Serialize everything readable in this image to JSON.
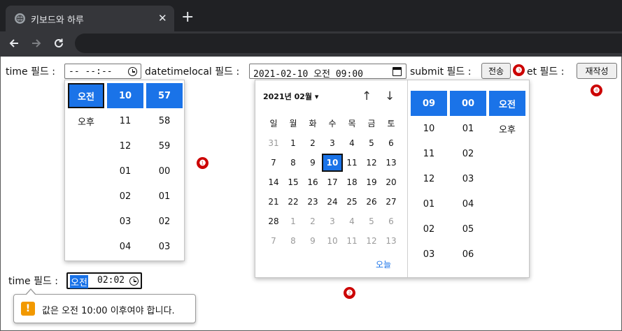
{
  "browser": {
    "tab_title": "키보드와 하루",
    "tab_close": "✕",
    "new_tab": "+"
  },
  "form": {
    "time_label": "time 필드 :",
    "time_value": "-- --:--",
    "datetimelocal_label": "datetimelocal 필드 :",
    "datetimelocal_value": "2021-02-10 오전 09:00",
    "submit_label": "submit 필드 :",
    "submit_button": "전송",
    "reset_label": "et 필드 :",
    "reset_button": "재작성",
    "time2_label": "time 필드 :",
    "time2_ampm": "오전",
    "time2_value": "02:02"
  },
  "time_picker": {
    "ampm": [
      "오전",
      "오후"
    ],
    "hours": [
      "10",
      "11",
      "12",
      "01",
      "02",
      "03",
      "04"
    ],
    "minutes": [
      "57",
      "58",
      "59",
      "00",
      "01",
      "02",
      "03"
    ]
  },
  "calendar": {
    "month_label": "2021년 02월 ▾",
    "up_arrow": "↑",
    "down_arrow": "↓",
    "weekdays": [
      "일",
      "월",
      "화",
      "수",
      "목",
      "금",
      "토"
    ],
    "weeks": [
      [
        "31",
        "1",
        "2",
        "3",
        "4",
        "5",
        "6"
      ],
      [
        "7",
        "8",
        "9",
        "10",
        "11",
        "12",
        "13"
      ],
      [
        "14",
        "15",
        "16",
        "17",
        "18",
        "19",
        "20"
      ],
      [
        "21",
        "22",
        "23",
        "24",
        "25",
        "26",
        "27"
      ],
      [
        "28",
        "1",
        "2",
        "3",
        "4",
        "5",
        "6"
      ],
      [
        "7",
        "8",
        "9",
        "10",
        "11",
        "12",
        "13"
      ]
    ],
    "selected_day": "10",
    "today_label": "오늘",
    "hours": [
      "09",
      "10",
      "11",
      "12",
      "01",
      "02",
      "03"
    ],
    "minutes": [
      "00",
      "01",
      "02",
      "03",
      "04",
      "05",
      "06"
    ],
    "ampm": [
      "오전",
      "오후"
    ]
  },
  "markers": {
    "m1": "❶",
    "m2": "❷",
    "m3": "❸",
    "m4": "❹"
  },
  "tooltip": {
    "icon": "!",
    "text": "값은 오전 10:00 이후여야 합니다."
  },
  "colors": {
    "accent": "#1a73e8",
    "marker": "#cc0000",
    "warning": "#f29900"
  }
}
